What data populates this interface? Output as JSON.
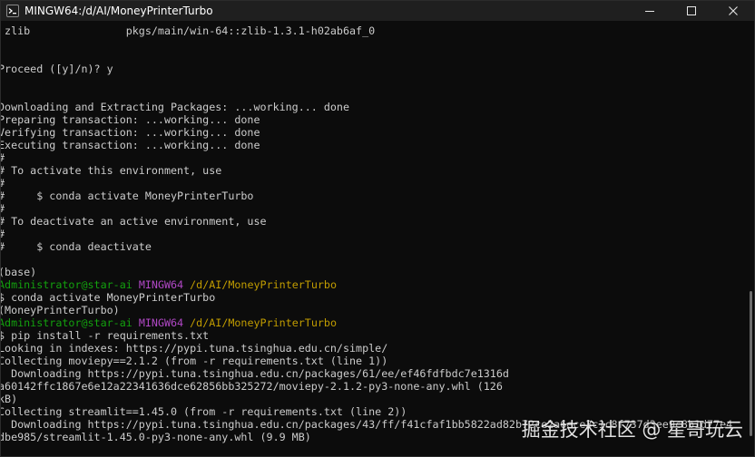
{
  "window": {
    "title": "MINGW64:/d/AI/MoneyPrinterTurbo",
    "app_icon": "mingw-icon",
    "controls": {
      "minimize_icon": "minimize-icon",
      "maximize_icon": "maximize-icon",
      "close_icon": "close-icon"
    }
  },
  "colors": {
    "background": "#0c0c0c",
    "titlebar": "#1f1f1f",
    "text": "#cccccc",
    "user_host": "#13a10e",
    "mingw": "#b148c6",
    "path": "#c19c00"
  },
  "terminal": {
    "lines": [
      {
        "text": " zlib               pkgs/main/win-64::zlib-1.3.1-h02ab6af_0"
      },
      {
        "text": ""
      },
      {
        "text": ""
      },
      {
        "text": "Proceed ([y]/n)? y"
      },
      {
        "text": ""
      },
      {
        "text": ""
      },
      {
        "text": "Downloading and Extracting Packages: ...working... done"
      },
      {
        "text": "Preparing transaction: ...working... done"
      },
      {
        "text": "Verifying transaction: ...working... done"
      },
      {
        "text": "Executing transaction: ...working... done"
      },
      {
        "text": "#"
      },
      {
        "text": "# To activate this environment, use"
      },
      {
        "text": "#"
      },
      {
        "text": "#     $ conda activate MoneyPrinterTurbo"
      },
      {
        "text": "#"
      },
      {
        "text": "# To deactivate an active environment, use"
      },
      {
        "text": "#"
      },
      {
        "text": "#     $ conda deactivate"
      },
      {
        "text": ""
      },
      {
        "text": "(base)"
      },
      {
        "prompt": {
          "user": "Administrator@star-ai",
          "system": "MINGW64",
          "path": "/d/AI/MoneyPrinterTurbo"
        }
      },
      {
        "text": "$ conda activate MoneyPrinterTurbo"
      },
      {
        "text": "(MoneyPrinterTurbo)"
      },
      {
        "prompt": {
          "user": "Administrator@star-ai",
          "system": "MINGW64",
          "path": "/d/AI/MoneyPrinterTurbo"
        }
      },
      {
        "text": "$ pip install -r requirements.txt"
      },
      {
        "text": "Looking in indexes: https://pypi.tuna.tsinghua.edu.cn/simple/"
      },
      {
        "text": "Collecting moviepy==2.1.2 (from -r requirements.txt (line 1))"
      },
      {
        "text": "  Downloading https://pypi.tuna.tsinghua.edu.cn/packages/61/ee/ef46fdfbdc7e1316d"
      },
      {
        "text": "a60142ffc1867e6e12a22341636dce62856bb325272/moviepy-2.1.2-py3-none-any.whl (126"
      },
      {
        "text": "kB)"
      },
      {
        "text": "Collecting streamlit==1.45.0 (from -r requirements.txt (line 2))"
      },
      {
        "text": "  Downloading https://pypi.tuna.tsinghua.edu.cn/packages/43/ff/f41cfaf1bb5822ad82b72ce2a6ece3c1c8f737d3ee9c8b1d77e4"
      },
      {
        "text": "dbe985/streamlit-1.45.0-py3-none-any.whl (9.9 MB)"
      }
    ]
  },
  "watermark": "掘金技术社区 @ 星哥玩云"
}
